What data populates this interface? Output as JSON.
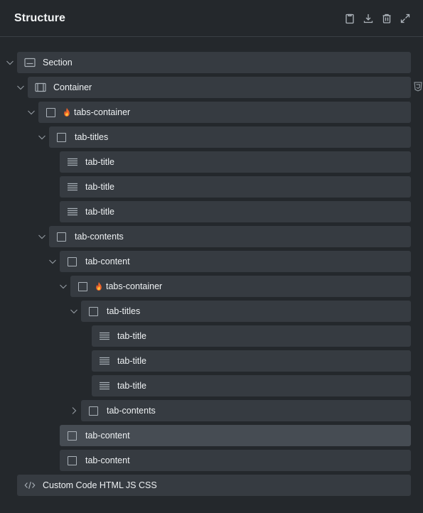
{
  "panel": {
    "title": "Structure",
    "actions": [
      {
        "name": "clipboard-icon"
      },
      {
        "name": "download-icon"
      },
      {
        "name": "trash-icon"
      },
      {
        "name": "expand-icon"
      }
    ]
  },
  "tree": {
    "nodes": [
      {
        "label": "Section",
        "icon": "section-icon",
        "expanded": true
      },
      {
        "label": "Container",
        "icon": "container-icon",
        "expanded": true
      },
      {
        "label": "tabs-container",
        "icon": "checkbox",
        "badge": "fire-icon",
        "expanded": true
      },
      {
        "label": "tab-titles",
        "icon": "checkbox",
        "expanded": true
      },
      {
        "label": "tab-title",
        "icon": "lines-icon"
      },
      {
        "label": "tab-title",
        "icon": "lines-icon"
      },
      {
        "label": "tab-title",
        "icon": "lines-icon"
      },
      {
        "label": "tab-contents",
        "icon": "checkbox",
        "expanded": true
      },
      {
        "label": "tab-content",
        "icon": "checkbox",
        "expanded": true
      },
      {
        "label": "tabs-container",
        "icon": "checkbox",
        "badge": "fire-icon",
        "expanded": true
      },
      {
        "label": "tab-titles",
        "icon": "checkbox",
        "expanded": true
      },
      {
        "label": "tab-title",
        "icon": "lines-icon"
      },
      {
        "label": "tab-title",
        "icon": "lines-icon"
      },
      {
        "label": "tab-title",
        "icon": "lines-icon"
      },
      {
        "label": "tab-contents",
        "icon": "checkbox",
        "expanded": false
      },
      {
        "label": "tab-content",
        "icon": "checkbox",
        "selected": true
      },
      {
        "label": "tab-content",
        "icon": "checkbox"
      },
      {
        "label": "Custom Code HTML JS CSS",
        "icon": "code-icon"
      }
    ]
  },
  "side_marker": {
    "icon": "css3-shield-icon"
  }
}
